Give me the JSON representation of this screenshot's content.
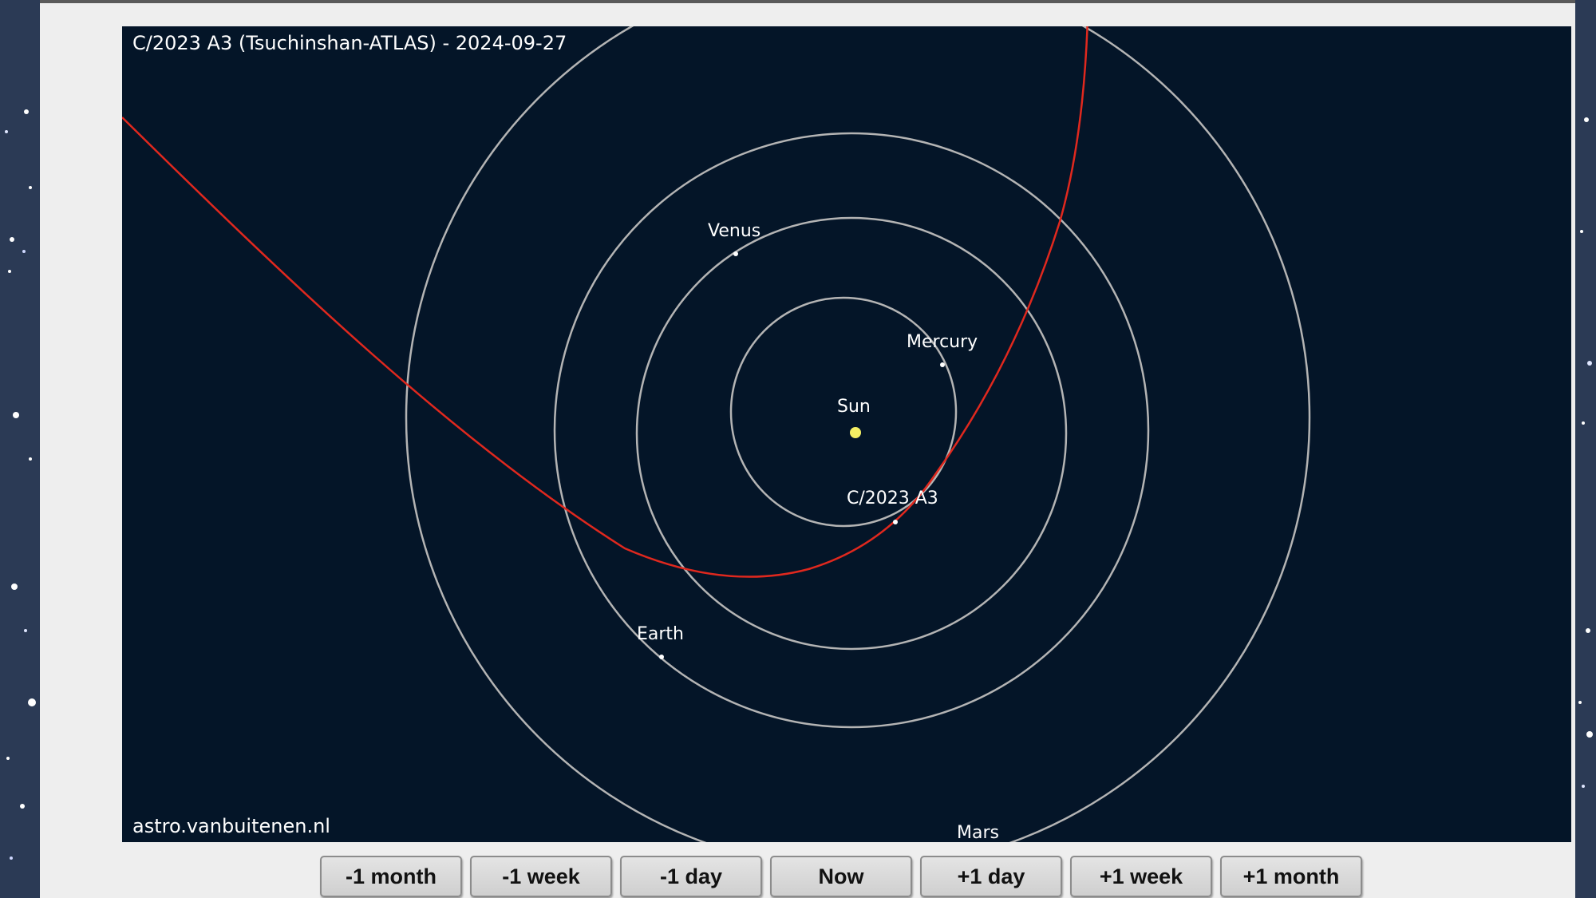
{
  "map": {
    "title": "C/2023 A3 (Tsuchinshan-ATLAS) - 2024-09-27",
    "credit": "astro.vanbuitenen.nl",
    "colors": {
      "background": "#041528",
      "orbit": "#b4b4b4",
      "comet_path": "#e0281e",
      "sun": "#f5f064",
      "planet_dot": "#ffffff",
      "label": "#ffffff"
    },
    "bodies": {
      "sun": "Sun",
      "mercury": "Mercury",
      "venus": "Venus",
      "earth": "Earth",
      "mars": "Mars",
      "comet": "C/2023 A3"
    }
  },
  "nav": {
    "minus_month": "-1 month",
    "minus_week": "-1 week",
    "minus_day": "-1 day",
    "now": "Now",
    "plus_day": "+1 day",
    "plus_week": "+1 week",
    "plus_month": "+1 month"
  }
}
